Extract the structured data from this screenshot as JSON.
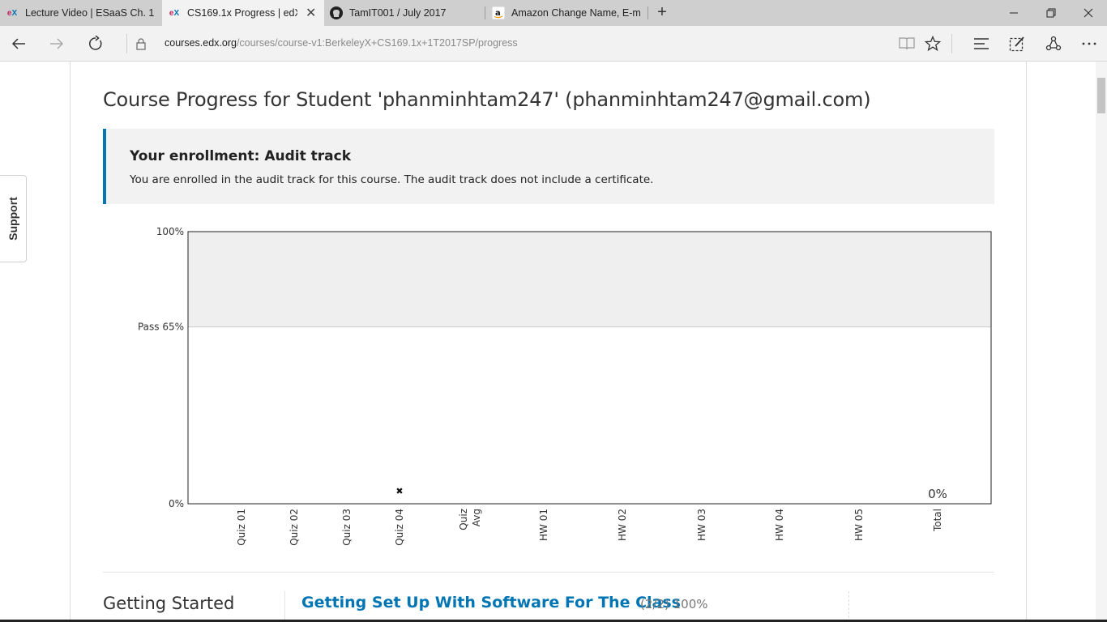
{
  "browser": {
    "tabs": [
      {
        "title": "Lecture Video | ESaaS Ch. 1.",
        "icon": "edx-icon",
        "active": false
      },
      {
        "title": "CS169.1x Progress | edX",
        "icon": "edx-icon",
        "active": true
      },
      {
        "title": "TamIT001 / July 2017",
        "icon": "github-icon",
        "active": false
      },
      {
        "title": "Amazon Change Name, E-m",
        "icon": "amazon-icon",
        "active": false
      }
    ],
    "url_host": "courses.edx.org",
    "url_path": "/courses/course-v1:BerkeleyX+CS169.1x+1T2017SP/progress"
  },
  "support_label": "Support",
  "page_title": "Course Progress for Student 'phanminhtam247' (phanminhtam247@gmail.com)",
  "enrollment": {
    "title": "Your enrollment: Audit track",
    "message": "You are enrolled in the audit track for this course. The audit track does not include a certificate."
  },
  "chart_data": {
    "type": "bar",
    "categories": [
      "Quiz 01",
      "Quiz 02",
      "Quiz 03",
      "Quiz 04",
      "Quiz Avg",
      "HW 01",
      "HW 02",
      "HW 03",
      "HW 04",
      "HW 05",
      "Total"
    ],
    "values": [
      0,
      0,
      0,
      0,
      0,
      0,
      0,
      0,
      0,
      0,
      0
    ],
    "ylim": [
      0,
      100
    ],
    "y_ticks": [
      {
        "value": 100,
        "label": "100%"
      },
      {
        "value": 65,
        "label": "Pass 65%"
      },
      {
        "value": 0,
        "label": "0%"
      }
    ],
    "pass_threshold": 65,
    "dropped_marker": {
      "category": "Quiz 04",
      "symbol": "✖"
    },
    "total_label": "0%",
    "colors": {
      "passing_band": "#efefef",
      "plot_border": "#222222",
      "pass_line": "#cccccc"
    }
  },
  "grades": {
    "chapter": "Getting Started",
    "section_title": "Getting Set Up With Software For The Class",
    "section_score": "(2/2) 100%"
  }
}
